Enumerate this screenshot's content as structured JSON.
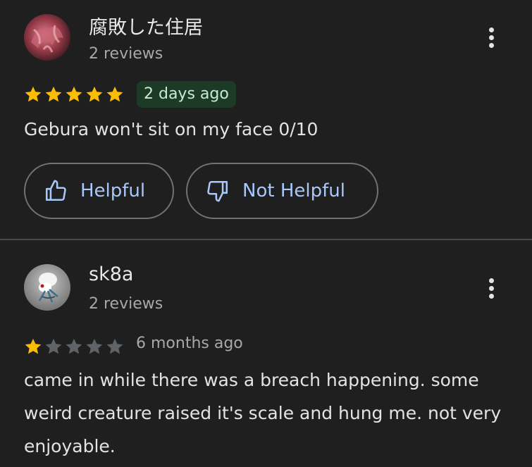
{
  "reviews": [
    {
      "author": "腐敗した住居",
      "review_count": "2 reviews",
      "rating": 5,
      "max_rating": 5,
      "time": "2 days ago",
      "text": "Gebura won't sit on my face 0/10",
      "actions": {
        "helpful_label": "Helpful",
        "not_helpful_label": "Not Helpful"
      }
    },
    {
      "author": "sk8a",
      "review_count": "2 reviews",
      "rating": 1,
      "max_rating": 5,
      "time": "6 months ago",
      "text": "came in while there was a breach happening. some weird creature raised it's scale and hung me. not very enjoyable."
    }
  ],
  "colors": {
    "background": "#1f1f1f",
    "star_filled": "#fbbc04",
    "star_empty": "#5f6368",
    "accent": "#a8c7fa",
    "new_badge_bg": "#1d3a27"
  },
  "icons": {
    "more": "more-vert-icon",
    "helpful": "thumb-up-icon",
    "not_helpful": "thumb-down-icon",
    "star": "star-icon"
  }
}
